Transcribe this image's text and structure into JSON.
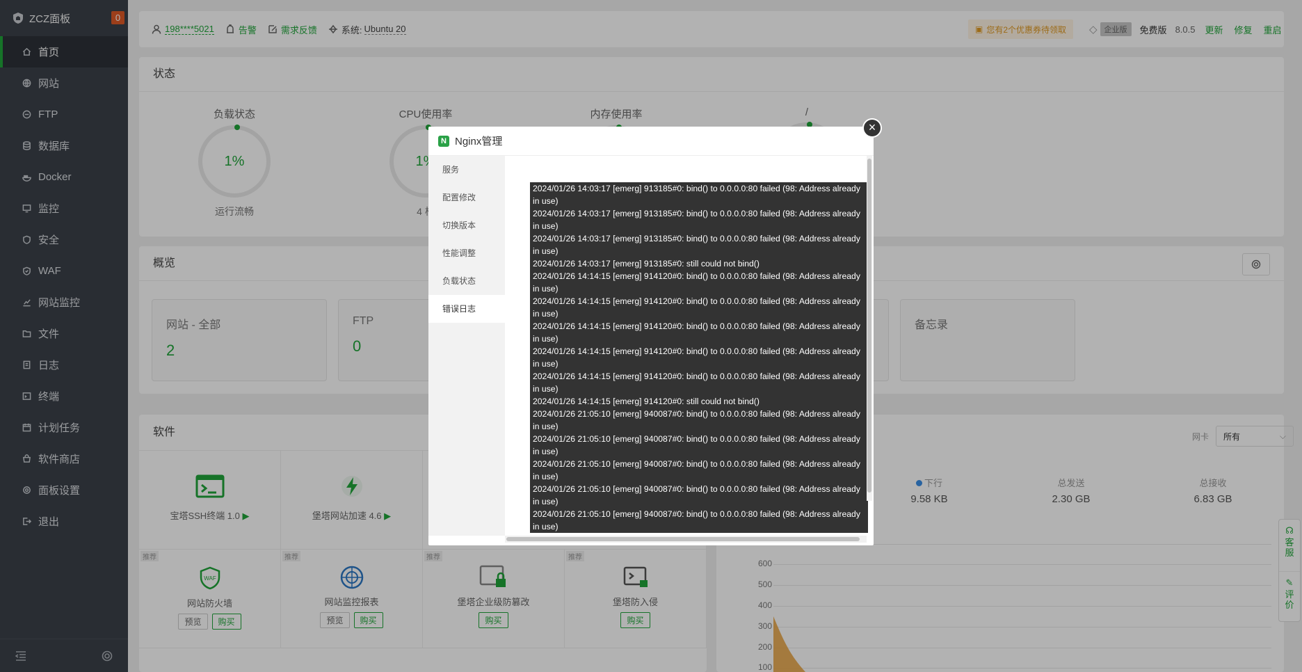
{
  "brand": {
    "title": "ZCZ面板",
    "count": "0"
  },
  "sidebar": {
    "items": [
      {
        "label": "首页",
        "icon": "home-icon"
      },
      {
        "label": "网站",
        "icon": "globe-icon"
      },
      {
        "label": "FTP",
        "icon": "ftp-icon"
      },
      {
        "label": "数据库",
        "icon": "database-icon"
      },
      {
        "label": "Docker",
        "icon": "docker-icon"
      },
      {
        "label": "监控",
        "icon": "monitor-icon"
      },
      {
        "label": "安全",
        "icon": "shield-icon"
      },
      {
        "label": "WAF",
        "icon": "waf-icon"
      },
      {
        "label": "网站监控",
        "icon": "chart-icon"
      },
      {
        "label": "文件",
        "icon": "folder-icon"
      },
      {
        "label": "日志",
        "icon": "log-icon"
      },
      {
        "label": "终端",
        "icon": "terminal-icon"
      },
      {
        "label": "计划任务",
        "icon": "calendar-icon"
      },
      {
        "label": "软件商店",
        "icon": "store-icon"
      },
      {
        "label": "面板设置",
        "icon": "gear-icon"
      },
      {
        "label": "退出",
        "icon": "logout-icon"
      }
    ]
  },
  "header": {
    "user": "198****5021",
    "alarm": "告警",
    "feedback": "需求反馈",
    "system_label": "系统:",
    "system_value": "Ubuntu 20",
    "coupon": "您有2个优惠券待领取",
    "enterprise": "企业版",
    "edition": "免费版",
    "version": "8.0.5",
    "update": "更新",
    "repair": "修复",
    "restart": "重启"
  },
  "status": {
    "title": "状态",
    "gauges": [
      {
        "label": "负载状态",
        "value": "1%",
        "sub": "运行流畅"
      },
      {
        "label": "CPU使用率",
        "value": "1%",
        "sub": "4 核"
      },
      {
        "label": "内存使用率",
        "value": "",
        "sub": ""
      },
      {
        "label": "/",
        "value": "",
        "sub": ""
      }
    ]
  },
  "overview": {
    "title": "概览",
    "cards": [
      {
        "label": "网站 - 全部",
        "value": "2"
      },
      {
        "label": "FTP",
        "value": "0"
      },
      {
        "label": "备忘录",
        "value": ""
      }
    ]
  },
  "software": {
    "title": "软件",
    "top": [
      {
        "name": "宝塔SSH终端 1.0"
      },
      {
        "name": "堡塔网站加速 4.6"
      }
    ],
    "bottom": [
      {
        "name": "网站防火墙",
        "preview": "预览",
        "buy": "购买",
        "tag": "推荐"
      },
      {
        "name": "网站监控报表",
        "preview": "预览",
        "buy": "购买",
        "tag": "推荐"
      },
      {
        "name": "堡塔企业级防篡改",
        "buy": "购买",
        "tag": "推荐"
      },
      {
        "name": "堡塔防入侵",
        "buy": "购买",
        "tag": "推荐"
      }
    ]
  },
  "traffic": {
    "nic_label": "网卡",
    "nic_value": "所有",
    "down_label": "下行",
    "down_value": "9.58 KB",
    "sent_label": "总发送",
    "sent_value": "2.30 GB",
    "recv_label": "总接收",
    "recv_value": "6.83 GB",
    "y_ticks": [
      "600",
      "500",
      "400",
      "300",
      "200",
      "100"
    ],
    "series_color": "#e8a13c"
  },
  "modal": {
    "title": "Nginx管理",
    "menu": [
      "服务",
      "配置修改",
      "切换版本",
      "性能调整",
      "负载状态",
      "错误日志"
    ],
    "active_menu": "错误日志",
    "log_lines": [
      "2024/01/26 14:03:17 [emerg] 913185#0: bind() to 0.0.0.0:80 failed (98: Address already in use)",
      "2024/01/26 14:03:17 [emerg] 913185#0: bind() to 0.0.0.0:80 failed (98: Address already in use)",
      "2024/01/26 14:03:17 [emerg] 913185#0: bind() to 0.0.0.0:80 failed (98: Address already in use)",
      "2024/01/26 14:03:17 [emerg] 913185#0: still could not bind()",
      "2024/01/26 14:14:15 [emerg] 914120#0: bind() to 0.0.0.0:80 failed (98: Address already in use)",
      "2024/01/26 14:14:15 [emerg] 914120#0: bind() to 0.0.0.0:80 failed (98: Address already in use)",
      "2024/01/26 14:14:15 [emerg] 914120#0: bind() to 0.0.0.0:80 failed (98: Address already in use)",
      "2024/01/26 14:14:15 [emerg] 914120#0: bind() to 0.0.0.0:80 failed (98: Address already in use)",
      "2024/01/26 14:14:15 [emerg] 914120#0: bind() to 0.0.0.0:80 failed (98: Address already in use)",
      "2024/01/26 14:14:15 [emerg] 914120#0: still could not bind()",
      "2024/01/26 21:05:10 [emerg] 940087#0: bind() to 0.0.0.0:80 failed (98: Address already in use)",
      "2024/01/26 21:05:10 [emerg] 940087#0: bind() to 0.0.0.0:80 failed (98: Address already in use)",
      "2024/01/26 21:05:10 [emerg] 940087#0: bind() to 0.0.0.0:80 failed (98: Address already in use)",
      "2024/01/26 21:05:10 [emerg] 940087#0: bind() to 0.0.0.0:80 failed (98: Address already in use)",
      "2024/01/26 21:05:10 [emerg] 940087#0: bind() to 0.0.0.0:80 failed (98: Address already in use)"
    ]
  },
  "float": {
    "service": "客服",
    "review": "评价"
  },
  "colors": {
    "accent": "#20a53a",
    "sidebar_bg": "#3b4149",
    "warning": "#e05a26",
    "log_bg": "#333333"
  }
}
